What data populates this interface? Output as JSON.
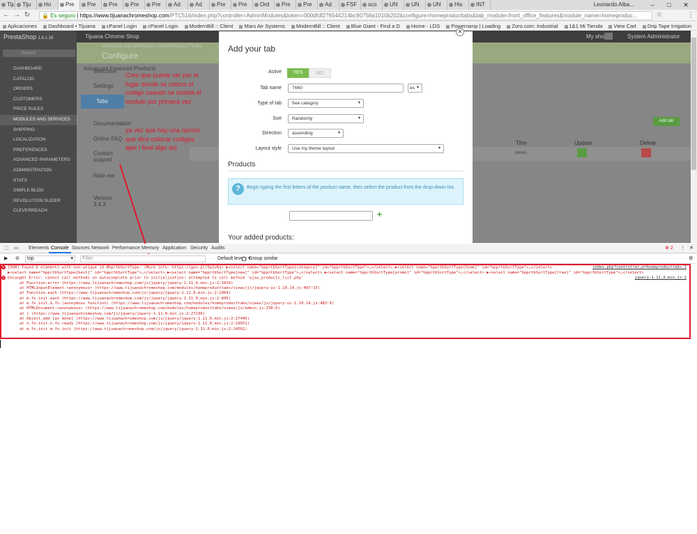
{
  "browser": {
    "tabs": [
      "Tiju",
      "Tiju",
      "Ho",
      "Pre",
      "Pre",
      "Pre",
      "Pre",
      "Pre",
      "Ad",
      "Ad",
      "Pre",
      "Pre",
      "Ord",
      "Pre",
      "Pre",
      "Ad",
      "FSF",
      "sco",
      "UN",
      "UN",
      "UN",
      "His",
      "INT"
    ],
    "profile": "Leonardo Alba...",
    "secure_label": "Es seguro",
    "url_host": "https://www.tijuanachromeshop.com",
    "url_path": "/PTC516/index.php?controller=AdminModules&token=000dfdf276544214bc90758a1010b202&configure=homeproducttabs&tab_module=front_office_features&module_name=homeproduc...",
    "bookmarks": [
      "Aplicaciones",
      "Dashboard • Tijuana",
      "cPanel Login",
      "cPanel Login",
      "ModernBill :: Client",
      "Mars Air Systems",
      "ModernBill :: Client",
      "Blue Giant - Find a D",
      "Home - LDS",
      "Powerramp | Loading",
      "Zoro.com: Industrial",
      "1&1 Mi Tienda",
      "View Cart",
      "Drip Tape Irrigation"
    ]
  },
  "admin": {
    "logo": "PrestaShop",
    "version": "1.6.1.16",
    "shop_name": "Tijuana Chrome Shop",
    "search_placeholder": "Search",
    "menu": [
      "DASHBOARD",
      "CATALOG",
      "ORDERS",
      "CUSTOMERS",
      "PRICE RULES",
      "MODULES AND SERVICES",
      "SHIPPING",
      "LOCALIZATION",
      "PREFERENCES",
      "ADVANCED PARAMETERS",
      "ADMINISTRATION",
      "STATS",
      "SIMPLE BLOG",
      "REVOLUTION SLIDER",
      "CLEVERREACH"
    ],
    "breadcrumb": "MODULES AND SERVICES / HOMEPRODUCTTABS",
    "page_title": "Configure",
    "module_title": "Advanced Featured Products",
    "my_shop": "My shop",
    "user": "System Administrator",
    "left_nav": [
      "Welcome",
      "Settings",
      "Tabs",
      "Documentation",
      "Online FAQ",
      "Contact support",
      "Rate me",
      "Version : 3.4.3"
    ],
    "add_tab": "Add tab",
    "col_title": "Titre",
    "col_update": "Update",
    "col_delete": "Delete",
    "row_title": "Valves"
  },
  "modal": {
    "title": "Add your tab",
    "active_label": "Active",
    "yes": "YES",
    "no": "NO",
    "tab_name_label": "Tab name",
    "tab_name_value": "T660",
    "lang": "es",
    "type_label": "Type of tab",
    "type_value": "free category",
    "sort_label": "Sort",
    "sort_value": "Randomly",
    "direction_label": "Direction",
    "direction_value": "ascending",
    "layout_label": "Layout style",
    "layout_value": "Use my theme layout",
    "products_title": "Products",
    "info_text": "Begin typing the first letters of the product name, then select the product from the drop-down list.",
    "added_title": "Your added products:"
  },
  "annotations": {
    "first": "Creo que puede ser por el lugar donde se coloco el codigo cuando se instala el modulo por primera vez",
    "second": "ya vez que hay una opcion que dice colocar codigos ajax l final algo asi"
  },
  "devtools": {
    "tabs": [
      "Elements",
      "Console",
      "Sources",
      "Network",
      "Performance",
      "Memory",
      "Application",
      "Security",
      "Audits"
    ],
    "error_count": "2",
    "context": "top",
    "filter_placeholder": "Filter",
    "levels": "Default levels ▾",
    "group_similar": "Group similar",
    "console_lines": [
      "[DOM] Found 6 elements with non-unique id #hprtbSortType: (More info: https://goo.gl/9p2vKq) ▶<select name=\"hpprtbSortType[category]\" id=\"hpprtbSortType\">…</select> ▶<select name=\"hpprtbSortType[home]\" id=\"hpprtbSortType\">…</select>",
      "▶<select name=\"hpprtbSortType[best]\" id=\"hpprtbSortType\">…</select> ▶<select name=\"hpprtbSortType[new]\" id=\"hpprtbSortType\">…</select> ▶<select name=\"hpprtbSortType[promo]\" id=\"hpprtbSortType\">…</select> ▶<select name=\"hpprtbSortType[free]\" id=\"hpprtbSortType\">…</select>",
      "Uncaught Error: cannot call methods on autocomplete prior to initialization; attempted to call method 'ajax_products_list.php'"
    ],
    "src1": "index.php?controller…e=homeproducttabs:1",
    "src2": "jquery-1.11.0.min.js:2",
    "stack": [
      "at Function.error (https://www.tijuanachromeshop.com/js/jquery/jquery-1.11.0.min.js:2:1819)",
      "at HTMLInputElement.<anonymous> (https://www.tijuanachromeshop.com/modules/homeproducttabs/views/js/jquery-ui-1.10.14.js:487:15)",
      "at Function.each (https://www.tijuanachromeshop.com/js/jquery/jquery-1.11.0.min.js:2:2969)",
      "at m.fn.init.each (https://www.tijuanachromeshop.com/js/jquery/jquery-1.11.0.min.js:2:845)",
      "at m.fn.init.$.fn.(anonymous function) (https://www.tijuanachromeshop.com/modules/homeproducttabs/views/js/jquery-ui-1.10.14.js:483:9)",
      "at HTMLDocument.<anonymous> (https://www.tijuanachromeshop.com/modules/homeproducttabs/views/js/admin.js:236:6)",
      "at j (https://www.tijuanachromeshop.com/js/jquery/jquery-1.11.0.min.js:2:27136)",
      "at Object.add [as done] (https://www.tijuanachromeshop.com/js/jquery/jquery-1.11.0.min.js:2:27445)",
      "at n.fn.init.n.fn.ready (https://www.tijuanachromeshop.com/js/jquery/jquery-1.11.0.min.js:2:29551)",
      "at m.fn.init.m.fn.init (https://www.tijuanachromeshop.com/js/jquery/jquery-1.11.0.min.js:2:24562)"
    ]
  }
}
